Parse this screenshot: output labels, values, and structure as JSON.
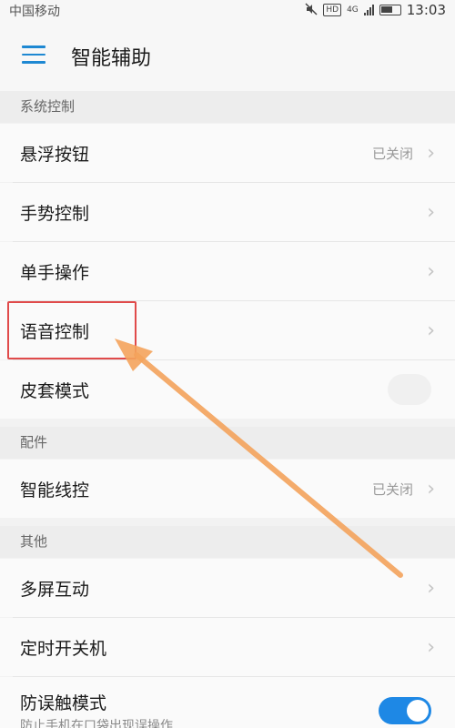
{
  "status_bar": {
    "carrier": "中国移动",
    "network": "4G",
    "hd": "HD",
    "time": "13:03"
  },
  "header": {
    "title": "智能辅助"
  },
  "sections": {
    "system": "系统控制",
    "accessories": "配件",
    "other": "其他"
  },
  "rows": {
    "floating_button": {
      "label": "悬浮按钮",
      "value": "已关闭"
    },
    "gesture_control": {
      "label": "手势控制"
    },
    "one_hand": {
      "label": "单手操作"
    },
    "voice_control": {
      "label": "语音控制"
    },
    "cover_mode": {
      "label": "皮套模式"
    },
    "smart_wire": {
      "label": "智能线控",
      "value": "已关闭"
    },
    "multi_screen": {
      "label": "多屏互动"
    },
    "scheduled_power": {
      "label": "定时开关机"
    },
    "mistouch_mode": {
      "label": "防误触模式",
      "sublabel": "防止手机在口袋出现误操作",
      "toggle_on": true
    }
  },
  "colors": {
    "accent": "#1e88e5",
    "highlight": "#e04a4a",
    "arrow": "#f4a35c"
  }
}
